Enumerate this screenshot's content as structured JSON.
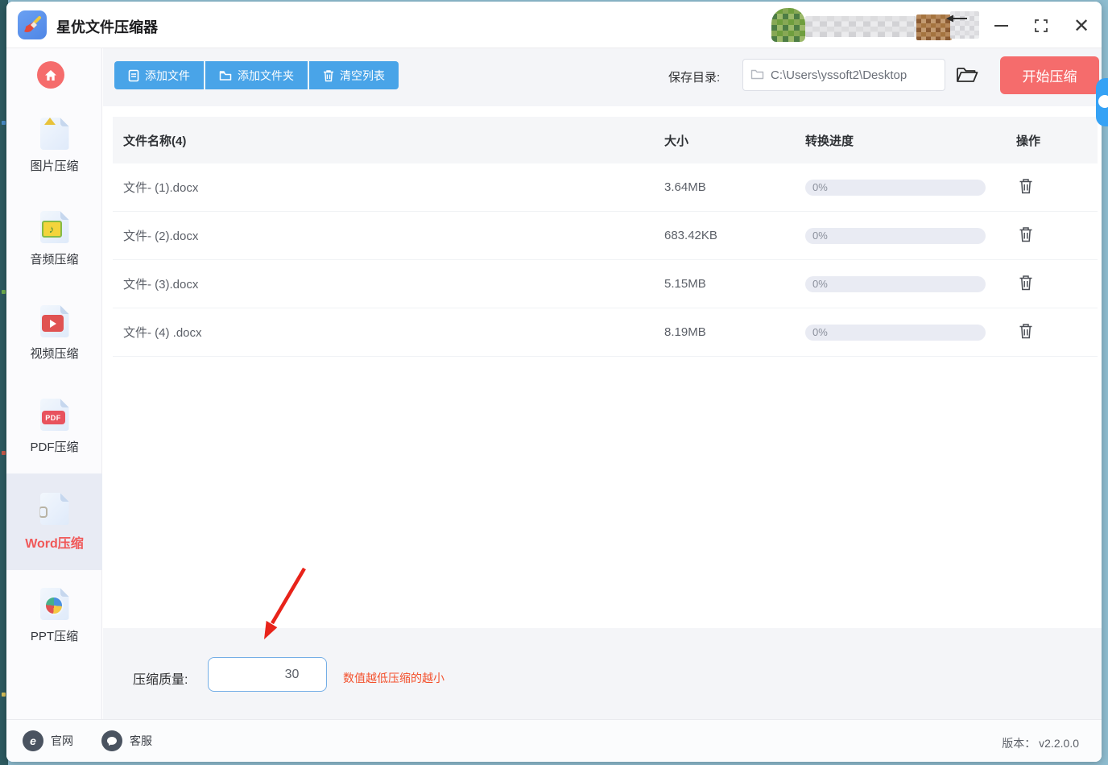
{
  "titlebar": {
    "app_title": "星优文件压缩器"
  },
  "toolbar": {
    "add_file": "添加文件",
    "add_folder": "添加文件夹",
    "clear_list": "清空列表",
    "save_dir_label": "保存目录:",
    "save_dir_value": "C:\\Users\\yssoft2\\Desktop",
    "start_button": "开始压缩"
  },
  "sidebar": {
    "items": [
      {
        "label": "图片压缩",
        "icon": "image-file-icon",
        "selected": false
      },
      {
        "label": "音频压缩",
        "icon": "audio-file-icon",
        "selected": false
      },
      {
        "label": "视频压缩",
        "icon": "video-file-icon",
        "selected": false
      },
      {
        "label": "PDF压缩",
        "icon": "pdf-file-icon",
        "selected": false
      },
      {
        "label": "Word压缩",
        "icon": "word-file-icon",
        "selected": true
      },
      {
        "label": "PPT压缩",
        "icon": "ppt-file-icon",
        "selected": false
      }
    ]
  },
  "table": {
    "headers": {
      "name": "文件名称(4)",
      "size": "大小",
      "progress": "转换进度",
      "action": "操作"
    },
    "rows": [
      {
        "name": "文件- (1).docx",
        "size": "3.64MB",
        "progress": "0%"
      },
      {
        "name": "文件- (2).docx",
        "size": "683.42KB",
        "progress": "0%"
      },
      {
        "name": "文件- (3).docx",
        "size": "5.15MB",
        "progress": "0%"
      },
      {
        "name": "文件- (4) .docx",
        "size": "8.19MB",
        "progress": "0%"
      }
    ]
  },
  "quality": {
    "label": "压缩质量:",
    "value": "30",
    "hint": "数值越低压缩的越小"
  },
  "footer": {
    "website": "官网",
    "support": "客服",
    "version": "版本： v2.2.0.0"
  },
  "colors": {
    "accent_blue": "#49a4e8",
    "accent_red": "#f56c6c",
    "selected_text": "#f05959",
    "hint_red": "#f3502c",
    "selected_bg": "#e8ebf4"
  }
}
